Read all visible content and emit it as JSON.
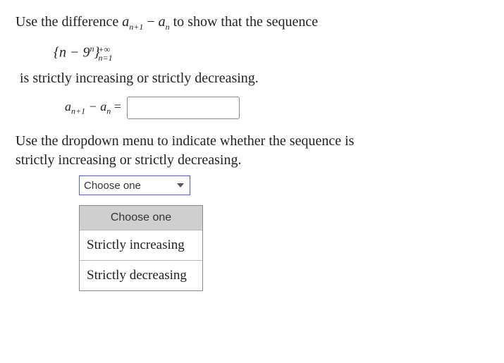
{
  "text": {
    "line1_a": "Use the difference ",
    "expr_anp1": "a",
    "expr_np1": "n+1",
    "minus": " − ",
    "expr_an_a": "a",
    "expr_an_n": "n",
    "line1_b": " to show that the sequence",
    "seq_open": "{",
    "seq_n": "n",
    "seq_minus": " − 9",
    "seq_exp": "n",
    "seq_close": "}",
    "seq_sup": "+∞",
    "seq_sub": "n=1",
    "line3": "is strictly increasing or strictly decreasing.",
    "diff_lhs_a1": "a",
    "diff_lhs_s1": "n+1",
    "diff_lhs_m": " − ",
    "diff_lhs_a2": "a",
    "diff_lhs_s2": "n",
    "diff_eq": " = ",
    "line5": "Use the dropdown menu to indicate whether the sequence is",
    "line6": "strictly increasing or strictly decreasing."
  },
  "input": {
    "difference_value": ""
  },
  "dropdown": {
    "selected": "Choose one",
    "options": {
      "placeholder": "Choose one",
      "opt1": "Strictly increasing",
      "opt2": "Strictly decreasing"
    }
  }
}
